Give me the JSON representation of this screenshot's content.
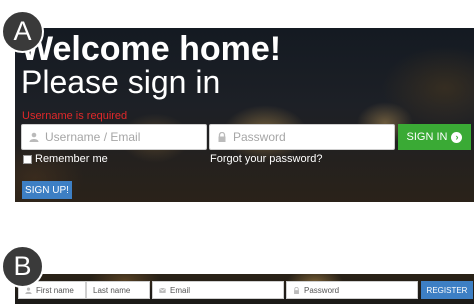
{
  "labels": {
    "a": "A",
    "b": "B"
  },
  "login": {
    "title_line1": "Welcome home!",
    "title_line2": "Please sign in",
    "error": "Username is required",
    "username_placeholder": "Username / Email",
    "password_placeholder": "Password",
    "signin_label": "SIGN IN",
    "remember_label": "Remember me",
    "forgot_label": "Forgot your password?",
    "signup_label": "SIGN UP!"
  },
  "register": {
    "first_name": "First name",
    "last_name": "Last name",
    "email": "Email",
    "password": "Password",
    "register_label": "REGISTER"
  },
  "colors": {
    "signin_green": "#3aaa35",
    "primary_blue": "#3d7fc4",
    "error_red": "#e0282a",
    "badge_gray": "#3a3a3a"
  },
  "icons": [
    "user-icon",
    "lock-icon",
    "email-icon",
    "arrow-right-circle-icon"
  ]
}
